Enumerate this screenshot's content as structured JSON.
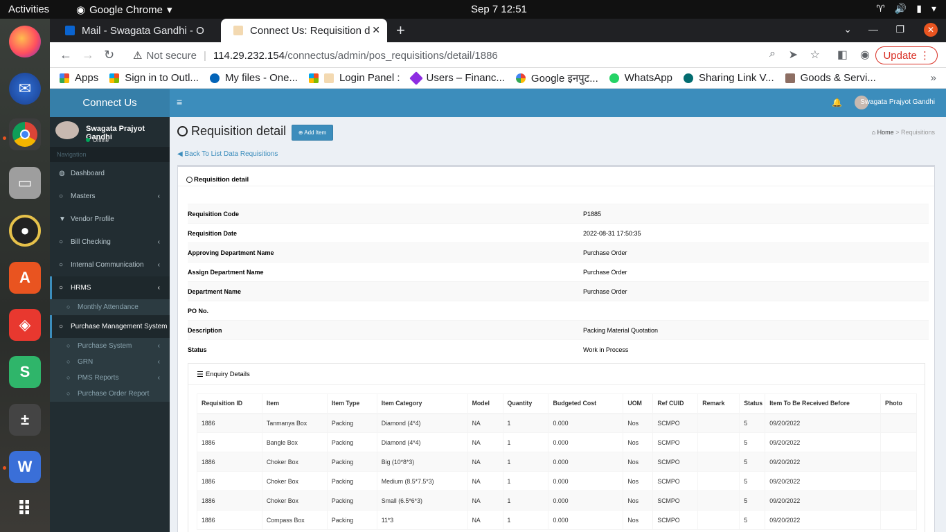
{
  "os": {
    "activities": "Activities",
    "app_name": "Google Chrome",
    "clock": "Sep 7  12:51"
  },
  "browser": {
    "tabs": [
      {
        "label": "Mail - Swagata Gandhi - O"
      },
      {
        "label": "Connect Us: Requisition d"
      }
    ],
    "url_warning": "Not secure",
    "url_host": "114.29.232.154",
    "url_path": "/connectus/admin/pos_requisitions/detail/1886",
    "update_label": "Update",
    "bookmarks": [
      "Apps",
      "Sign in to Outl...",
      "My files - One...",
      "Login Panel :",
      "Users – Financ...",
      "Google इनपुट...",
      "WhatsApp",
      "Sharing Link V...",
      "Goods & Servi..."
    ]
  },
  "sidebar": {
    "logo": "Connect Us",
    "user_name": "Swagata Prajyot Gandhi",
    "user_status": "Online",
    "nav_header": "Navigation",
    "items": [
      {
        "label": "Dashboard"
      },
      {
        "label": "Masters"
      },
      {
        "label": "Vendor Profile"
      },
      {
        "label": "Bill Checking"
      },
      {
        "label": "Internal Communication"
      },
      {
        "label": "HRMS"
      },
      {
        "label": "Monthly Attendance"
      },
      {
        "label": "Purchase Management System"
      },
      {
        "label": "Purchase System"
      },
      {
        "label": "GRN"
      },
      {
        "label": "PMS Reports"
      },
      {
        "label": "Purchase Order Report"
      }
    ]
  },
  "header": {
    "user_name": "Swagata Prajyot Gandhi"
  },
  "page": {
    "title": "Requisition detail",
    "add_item_label": "Add Item",
    "breadcrumb_home": "Home",
    "breadcrumb_sep": ">",
    "breadcrumb_current": "Requisitions",
    "back_link": "Back To List Data Requisitions",
    "box_title": "Requisition detail",
    "details": [
      {
        "key": "Requisition Code",
        "value": "P1885"
      },
      {
        "key": "Requisition Date",
        "value": "2022-08-31 17:50:35"
      },
      {
        "key": "Approving Department Name",
        "value": "Purchase Order"
      },
      {
        "key": "Assign Department Name",
        "value": "Purchase Order"
      },
      {
        "key": "Department Name",
        "value": "Purchase Order"
      },
      {
        "key": "PO No.",
        "value": ""
      },
      {
        "key": "Description",
        "value": "Packing Material Quotation"
      },
      {
        "key": "Status",
        "value": "Work in Process"
      }
    ],
    "enquiry_title": "Enquiry Details",
    "columns": [
      "Requisition ID",
      "Item",
      "Item Type",
      "Item Category",
      "Model",
      "Quantity",
      "Budgeted Cost",
      "UOM",
      "Ref CUID",
      "Remark",
      "Status",
      "Item To Be Received Before",
      "Photo"
    ],
    "rows": [
      [
        "1886",
        "Tanmanya Box",
        "Packing",
        "Diamond (4*4)",
        "NA",
        "1",
        "0.000",
        "Nos",
        "SCMPO",
        "",
        "5",
        "09/20/2022",
        ""
      ],
      [
        "1886",
        "Bangle Box",
        "Packing",
        "Diamond (4*4)",
        "NA",
        "1",
        "0.000",
        "Nos",
        "SCMPO",
        "",
        "5",
        "09/20/2022",
        ""
      ],
      [
        "1886",
        "Choker Box",
        "Packing",
        "Big (10*8*3)",
        "NA",
        "1",
        "0.000",
        "Nos",
        "SCMPO",
        "",
        "5",
        "09/20/2022",
        ""
      ],
      [
        "1886",
        "Choker Box",
        "Packing",
        "Medium (8.5*7.5*3)",
        "NA",
        "1",
        "0.000",
        "Nos",
        "SCMPO",
        "",
        "5",
        "09/20/2022",
        ""
      ],
      [
        "1886",
        "Choker Box",
        "Packing",
        "Small (6.5*6*3)",
        "NA",
        "1",
        "0.000",
        "Nos",
        "SCMPO",
        "",
        "5",
        "09/20/2022",
        ""
      ],
      [
        "1886",
        "Compass Box",
        "Packing",
        "11*3",
        "NA",
        "1",
        "0.000",
        "Nos",
        "SCMPO",
        "",
        "5",
        "09/20/2022",
        ""
      ]
    ]
  },
  "colors": {
    "sidebar_bg": "#222d32",
    "logo_bg": "#367fa9",
    "header_bg": "#3c8dbc",
    "accent": "#3c8dbc",
    "update_red": "#d93025"
  }
}
